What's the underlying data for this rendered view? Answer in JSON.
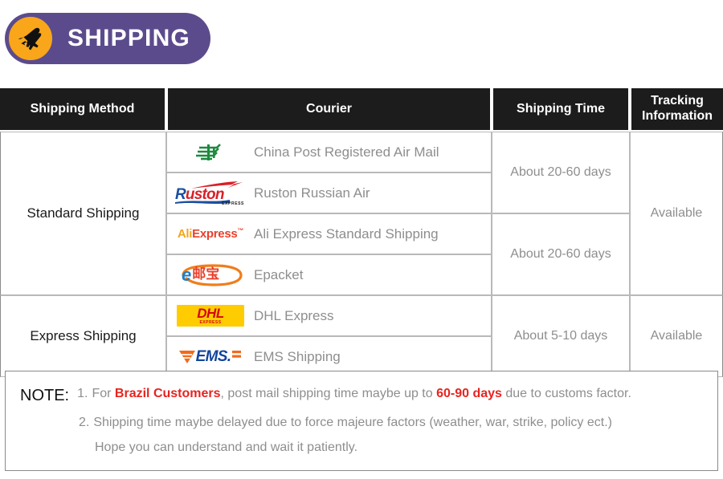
{
  "banner": {
    "title": "SHIPPING",
    "icon": "airplane-icon",
    "badge_color": "#5c4b8c",
    "circle_color": "#f9a61a"
  },
  "table": {
    "headers": {
      "method": "Shipping Method",
      "courier": "Courier",
      "time": "Shipping Time",
      "tracking_line1": "Tracking",
      "tracking_line2": "Information"
    },
    "groups": [
      {
        "method": "Standard Shipping",
        "tracking": "Available",
        "couriers": [
          {
            "logo": "china-post-logo",
            "name": "China Post Registered Air Mail"
          },
          {
            "logo": "ruston-logo",
            "name": "Ruston Russian Air"
          },
          {
            "logo": "aliexpress-logo",
            "name": "Ali Express Standard Shipping"
          },
          {
            "logo": "epacket-logo",
            "name": "Epacket"
          }
        ],
        "times": [
          {
            "label": "About 20-60 days",
            "rows": 2
          },
          {
            "label": "About 20-60 days",
            "rows": 2
          }
        ]
      },
      {
        "method": "Express Shipping",
        "tracking": "Available",
        "couriers": [
          {
            "logo": "dhl-logo",
            "name": "DHL Express"
          },
          {
            "logo": "ems-logo",
            "name": "EMS Shipping"
          }
        ],
        "times": [
          {
            "label": "About 5-10 days",
            "rows": 2
          }
        ]
      }
    ]
  },
  "logos": {
    "aliexpress": {
      "part1": "Ali",
      "part2": "Express",
      "tm": "™"
    },
    "dhl": {
      "text": "DHL",
      "sub": "EXPRESS"
    },
    "ems": {
      "text": "EMS."
    },
    "ruston": {
      "part1": "R",
      "part2": "uston",
      "sub": "EXPRESS"
    },
    "epacket": {
      "letter": "e",
      "chinese": "邮宝"
    }
  },
  "note": {
    "label": "NOTE:",
    "item1_num": "1.",
    "item1_a": "For ",
    "item1_red1": "Brazil Customers",
    "item1_b": ", post mail shipping time maybe up to ",
    "item1_red2": "60-90 days",
    "item1_c": " due to customs factor.",
    "item2_num": "2.",
    "item2_text": "Shipping time maybe delayed due to force majeure factors (weather, war, strike, policy ect.)",
    "item3_text": "Hope you can understand and wait it patiently."
  }
}
